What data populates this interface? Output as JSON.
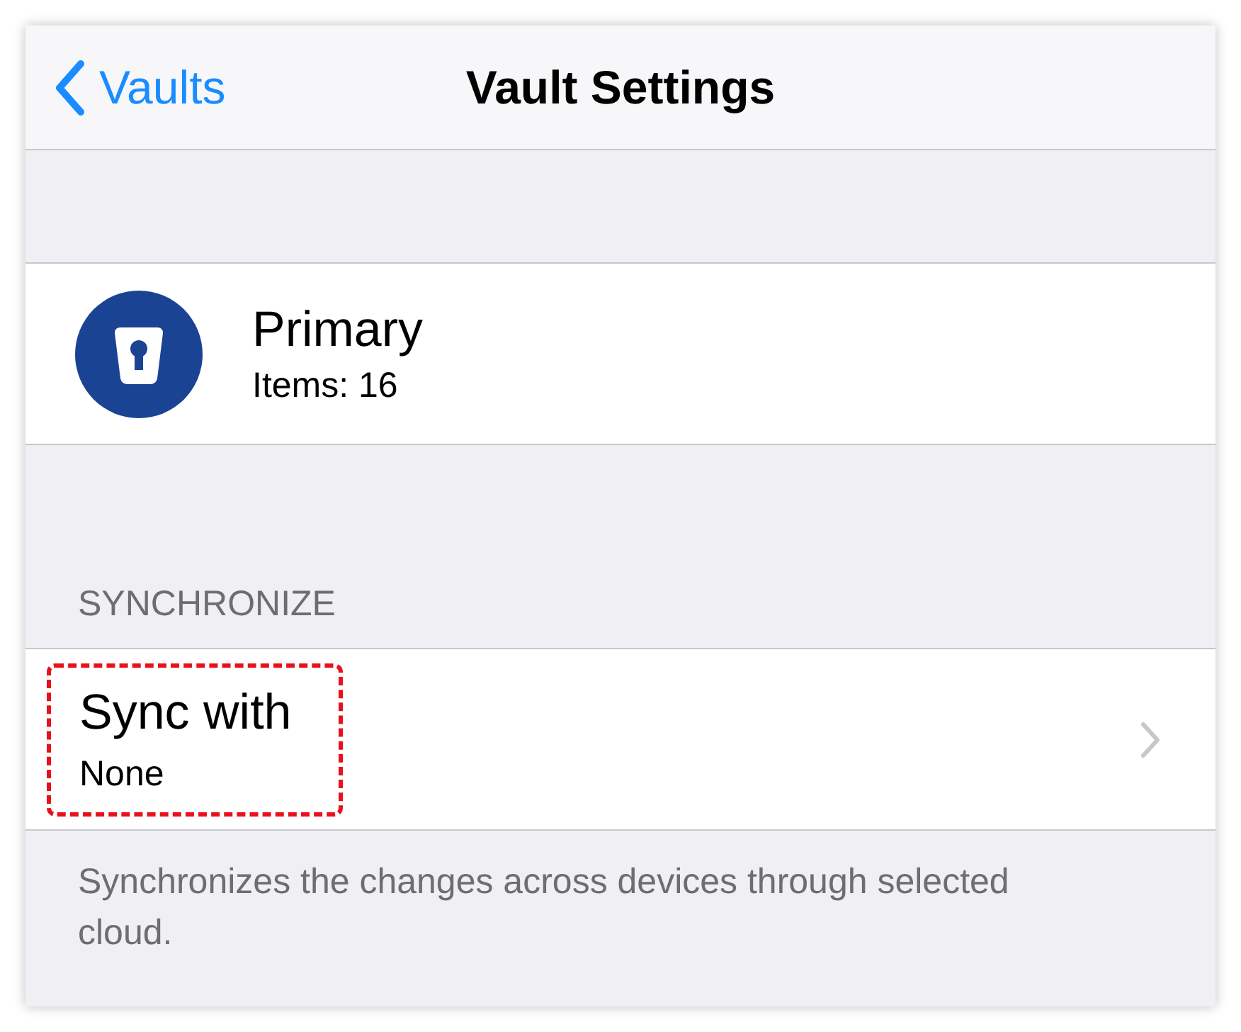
{
  "nav_bar": {
    "back_label": "Vaults",
    "title": "Vault Settings"
  },
  "vault": {
    "name": "Primary",
    "items": "Items: 16"
  },
  "sync_section": {
    "header": "SYNCHRONIZE",
    "row": {
      "label": "Sync with",
      "value": "None",
      "highlighted": true
    },
    "footer": "Synchronizes the changes across devices through selected cloud."
  }
}
